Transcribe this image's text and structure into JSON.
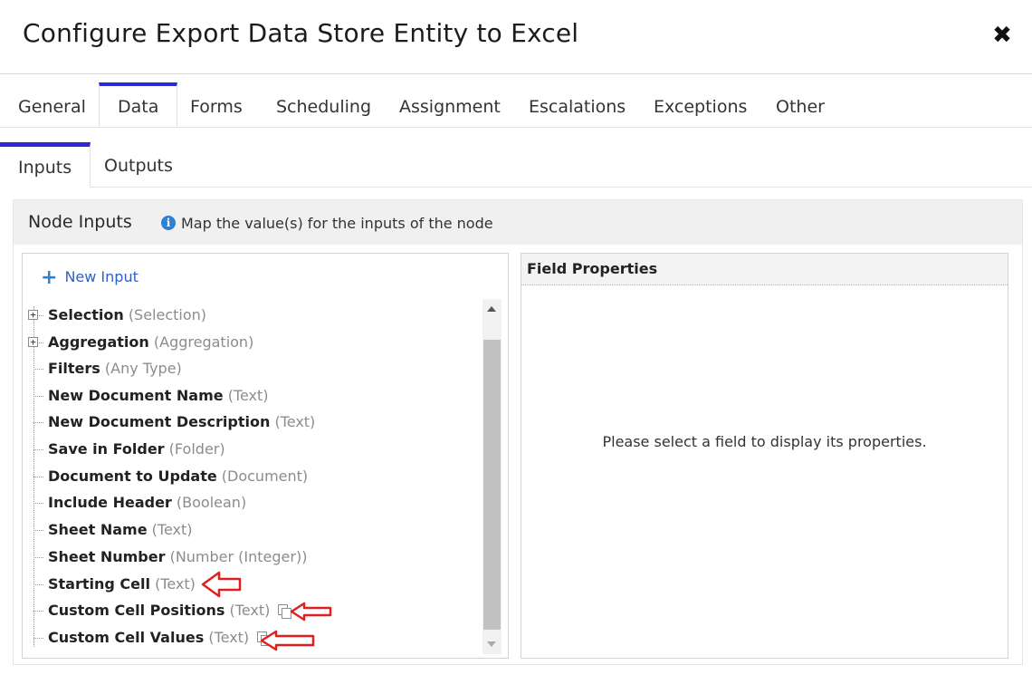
{
  "dialog": {
    "title": "Configure Export Data Store Entity to Excel",
    "close_glyph": "✖"
  },
  "tabs": [
    {
      "label": "General"
    },
    {
      "label": "Data",
      "active": true
    },
    {
      "label": "Forms"
    },
    {
      "label": "Scheduling"
    },
    {
      "label": "Assignment"
    },
    {
      "label": "Escalations"
    },
    {
      "label": "Exceptions"
    },
    {
      "label": "Other"
    }
  ],
  "subtabs": [
    {
      "label": "Inputs",
      "active": true
    },
    {
      "label": "Outputs"
    }
  ],
  "node_inputs": {
    "title": "Node Inputs",
    "info_text": "Map the value(s) for the inputs of the node",
    "new_input_label": "New Input",
    "items": [
      {
        "name": "Selection",
        "type": "(Selection)",
        "expandable": true
      },
      {
        "name": "Aggregation",
        "type": "(Aggregation)",
        "expandable": true
      },
      {
        "name": "Filters",
        "type": "(Any Type)"
      },
      {
        "name": "New Document Name",
        "type": "(Text)"
      },
      {
        "name": "New Document Description",
        "type": "(Text)"
      },
      {
        "name": "Save in Folder",
        "type": "(Folder)"
      },
      {
        "name": "Document to Update",
        "type": "(Document)"
      },
      {
        "name": "Include Header",
        "type": "(Boolean)"
      },
      {
        "name": "Sheet Name",
        "type": "(Text)"
      },
      {
        "name": "Sheet Number",
        "type": "(Number (Integer))"
      },
      {
        "name": "Starting Cell",
        "type": "(Text)"
      },
      {
        "name": "Custom Cell Positions",
        "type": "(Text)",
        "copy_icon": true
      },
      {
        "name": "Custom Cell Values",
        "type": "(Text)",
        "copy_icon": true
      }
    ]
  },
  "field_properties": {
    "title": "Field Properties",
    "placeholder": "Please select a field to display its properties."
  },
  "colors": {
    "accent": "#2b2bd6",
    "link": "#2f5fc8",
    "annotation_arrow": "#e02020"
  }
}
